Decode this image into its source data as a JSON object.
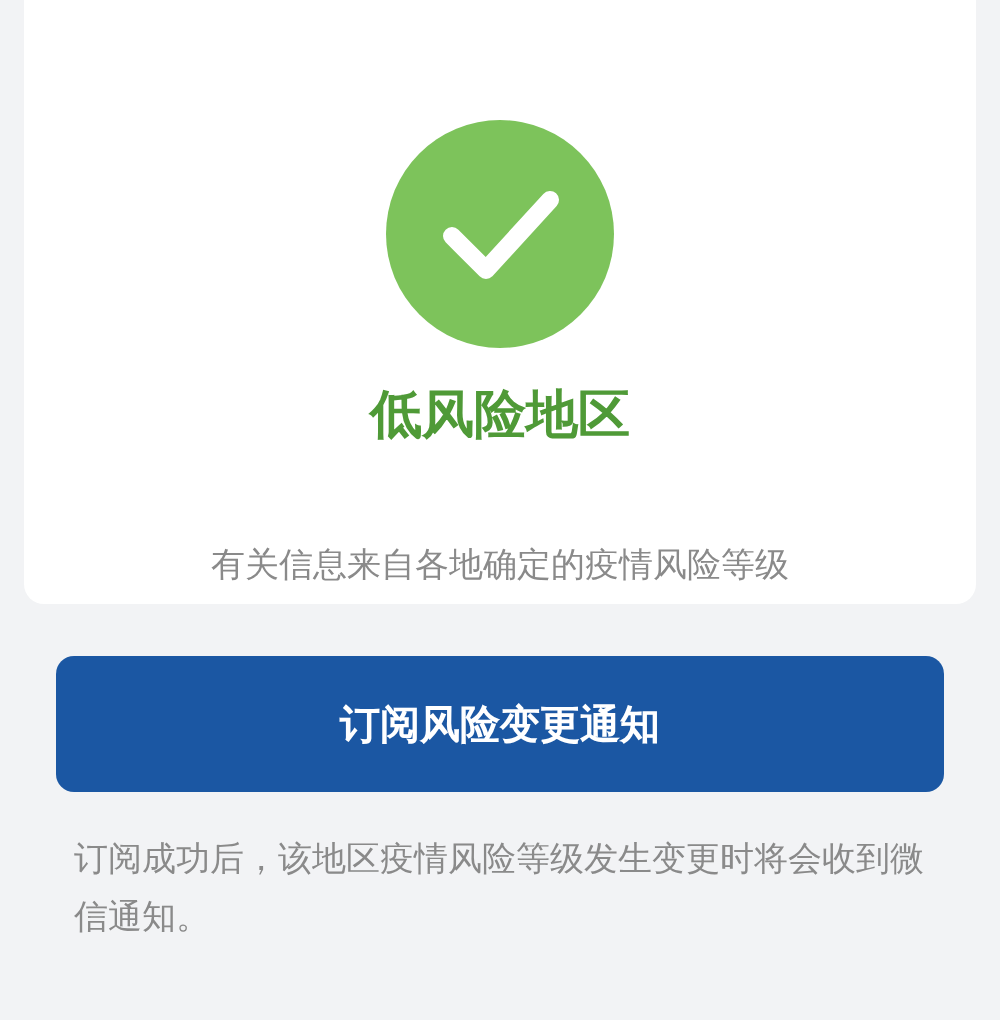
{
  "result": {
    "title": "低风险地区",
    "description": "有关信息来自各地确定的疫情风险等级"
  },
  "subscribe_button": {
    "label": "订阅风险变更通知"
  },
  "note": "订阅成功后，该地区疫情风险等级发生变更时将会收到微信通知。"
}
